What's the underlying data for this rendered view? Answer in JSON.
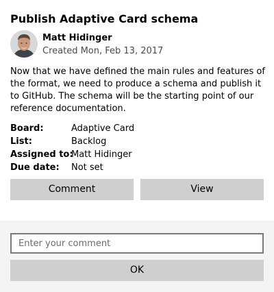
{
  "card": {
    "title": "Publish Adaptive Card schema",
    "author": {
      "name": "Matt Hidinger",
      "created": "Created Mon, Feb 13, 2017"
    },
    "description": "Now that we have defined the main rules and features of the format, we need to produce a schema and publish it to GitHub. The schema will be the starting point of our reference documentation.",
    "facts": [
      {
        "key": "Board:",
        "value": "Adaptive Card"
      },
      {
        "key": "List:",
        "value": "Backlog"
      },
      {
        "key": "Assigned to:",
        "value": "Matt Hidinger"
      },
      {
        "key": "Due date:",
        "value": "Not set"
      }
    ],
    "actions": {
      "comment_label": "Comment",
      "view_label": "View"
    }
  },
  "comment_panel": {
    "input_placeholder": "Enter your comment",
    "input_value": "",
    "ok_label": "OK"
  },
  "colors": {
    "button_bg": "#cfcfcf",
    "panel_bg": "#f4f4f4",
    "input_border": "#7a7a7a"
  }
}
